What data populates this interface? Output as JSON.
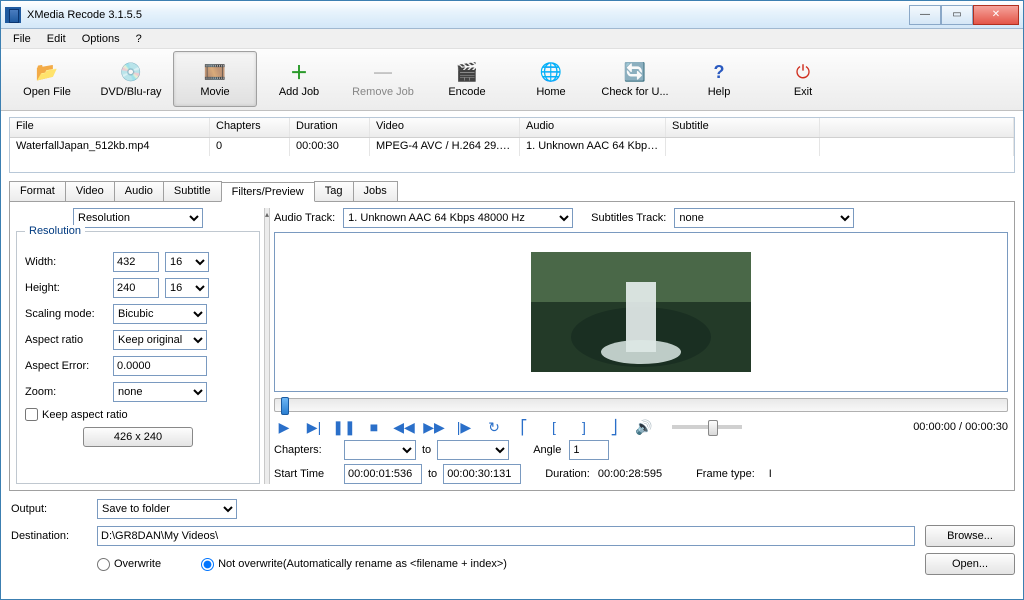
{
  "window": {
    "title": "XMedia Recode 3.1.5.5"
  },
  "menu": {
    "file": "File",
    "edit": "Edit",
    "options": "Options",
    "help": "?"
  },
  "toolbar": {
    "open_file": "Open File",
    "dvd": "DVD/Blu-ray",
    "movie": "Movie",
    "add_job": "Add Job",
    "remove_job": "Remove Job",
    "encode": "Encode",
    "home": "Home",
    "update": "Check for U...",
    "help": "Help",
    "exit": "Exit"
  },
  "filegrid": {
    "headers": {
      "file": "File",
      "chapters": "Chapters",
      "duration": "Duration",
      "video": "Video",
      "audio": "Audio",
      "subtitle": "Subtitle"
    },
    "row": {
      "file": "WaterfallJapan_512kb.mp4",
      "chapters": "0",
      "duration": "00:00:30",
      "video": "MPEG-4 AVC / H.264 29.9...",
      "audio": "1. Unknown AAC  64 Kbps...",
      "subtitle": ""
    }
  },
  "tabs": {
    "format": "Format",
    "video": "Video",
    "audio": "Audio",
    "subtitle": "Subtitle",
    "filters": "Filters/Preview",
    "tag": "Tag",
    "jobs": "Jobs"
  },
  "filters": {
    "section_select": "Resolution",
    "legend": "Resolution",
    "width_label": "Width:",
    "width": "432",
    "width_step": "16",
    "height_label": "Height:",
    "height": "240",
    "height_step": "16",
    "scaling_label": "Scaling mode:",
    "scaling": "Bicubic",
    "aspect_label": "Aspect ratio",
    "aspect": "Keep original",
    "aspect_err_label": "Aspect Error:",
    "aspect_err": "0.0000",
    "zoom_label": "Zoom:",
    "zoom": "none",
    "keep_aspect": "Keep aspect ratio",
    "size_btn": "426 x 240"
  },
  "preview": {
    "audio_label": "Audio Track:",
    "audio_track": "1. Unknown AAC  64 Kbps 48000 Hz",
    "sub_label": "Subtitles Track:",
    "sub_track": "none",
    "time": "00:00:00 / 00:00:30",
    "chapters_label": "Chapters:",
    "to": "to",
    "angle_label": "Angle",
    "angle": "1",
    "start_label": "Start Time",
    "start": "00:00:01:536",
    "end": "00:00:30:131",
    "duration_label": "Duration:",
    "duration": "00:00:28:595",
    "frametype_label": "Frame type:",
    "frametype": "I"
  },
  "output": {
    "output_label": "Output:",
    "output_mode": "Save to folder",
    "dest_label": "Destination:",
    "dest": "D:\\GR8DAN\\My Videos\\",
    "overwrite": "Overwrite",
    "not_overwrite": "Not overwrite(Automatically rename as <filename + index>)",
    "browse": "Browse...",
    "open": "Open..."
  }
}
